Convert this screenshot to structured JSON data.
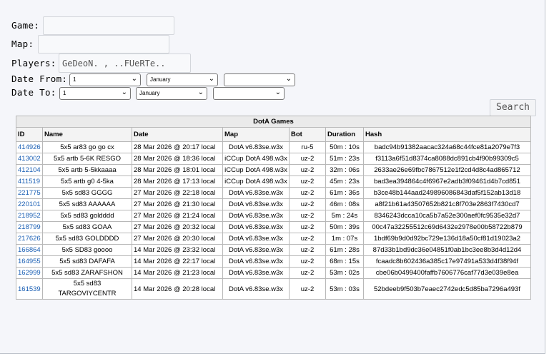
{
  "form": {
    "game_label": "Game:",
    "map_label": "Map:",
    "players_label": "Players:",
    "players_value": "GeDeoN. , ..FUeRTe..",
    "date_from_label": "Date From:",
    "date_to_label": "Date To:",
    "from_day": "1",
    "from_month": "January",
    "from_year": "",
    "to_day": "1",
    "to_month": "January",
    "to_year": "",
    "search_label": "Search"
  },
  "table": {
    "caption": "DotA Games",
    "headers": [
      "ID",
      "Name",
      "Date",
      "Map",
      "Bot",
      "Duration",
      "Hash"
    ],
    "rows": [
      [
        "414926",
        "5x5 ar83 go go cx",
        "28 Mar 2026 @ 20:17 local",
        "DotA v6.83se.w3x",
        "ru-5",
        "50m : 10s",
        "badc94b91382aacac324a68c44fce81a2079e7f3"
      ],
      [
        "413002",
        "5x5 artb 5-6K RESGO",
        "28 Mar 2026 @ 18:36 local",
        "iCCup DotA 498.w3x",
        "uz-2",
        "51m : 23s",
        "f3113a6f51d8374ca8088dc891cb4f90b99309c5"
      ],
      [
        "412104",
        "5x5 artb 5-5kkaaaa",
        "28 Mar 2026 @ 18:01 local",
        "iCCup DotA 498.w3x",
        "uz-2",
        "32m : 06s",
        "2633ae26e69fbc7867512e1f2cd4d8c4ad865712"
      ],
      [
        "411519",
        "5x5 artb g0 4-5ka",
        "28 Mar 2026 @ 17:13 local",
        "iCCup DotA 498.w3x",
        "uz-2",
        "45m : 23s",
        "bad3ea394864c4f6967e2adb3f09461d4b7cd851"
      ],
      [
        "221775",
        "5x5 sd83 GGGG",
        "27 Mar 2026 @ 22:18 local",
        "DotA v6.83se.w3x",
        "uz-2",
        "61m : 36s",
        "b3ce48b144aad249896086843daf5f152ab13d18"
      ],
      [
        "220101",
        "5x5 sd83 AAAAAA",
        "27 Mar 2026 @ 21:30 local",
        "DotA v6.83se.w3x",
        "uz-2",
        "46m : 08s",
        "a8f21b61a43507652b821c8f703e2863f7430cd7"
      ],
      [
        "218952",
        "5x5 sd83 goldddd",
        "27 Mar 2026 @ 21:24 local",
        "DotA v6.83se.w3x",
        "uz-2",
        "5m : 24s",
        "8346243dcca10ca5b7a52e300aef0fc9535e32d7"
      ],
      [
        "218799",
        "5x5 sd83 GOAA",
        "27 Mar 2026 @ 20:32 local",
        "DotA v6.83se.w3x",
        "uz-2",
        "50m : 39s",
        "00c47a32255512c69d6432e2978e00b58722b879"
      ],
      [
        "217626",
        "5x5 sd83 GOLDDDD",
        "27 Mar 2026 @ 20:30 local",
        "DotA v6.83se.w3x",
        "uz-2",
        "1m : 07s",
        "1bdf69b9d0d92bc729e136d18a50cf81d19023a2"
      ],
      [
        "166864",
        "5x5 SD83 goooo",
        "14 Mar 2026 @ 23:32 local",
        "DotA v6.83se.w3x",
        "uz-2",
        "61m : 28s",
        "87d33b1bd9dc36e04851f0ab1bc3ee8b3d4d12d4"
      ],
      [
        "164955",
        "5x5 sd83 DAFAFA",
        "14 Mar 2026 @ 22:17 local",
        "DotA v6.83se.w3x",
        "uz-2",
        "68m : 15s",
        "fcaadc8b602436a385c17e97491a533d4f38f94f"
      ],
      [
        "162999",
        "5x5 sd83 ZARAFSHON",
        "14 Mar 2026 @ 21:23 local",
        "DotA v6.83se.w3x",
        "uz-2",
        "53m : 02s",
        "cbe06b0499400faffb7606776caf77d3e039e8ea"
      ],
      [
        "161539",
        "5x5 sd83 TARGOVIYCENTR",
        "14 Mar 2026 @ 20:28 local",
        "DotA v6.83se.w3x",
        "uz-2",
        "53m : 03s",
        "52bdeeb9f503b7eaec2742edc5d85ba7296a493f"
      ]
    ]
  }
}
